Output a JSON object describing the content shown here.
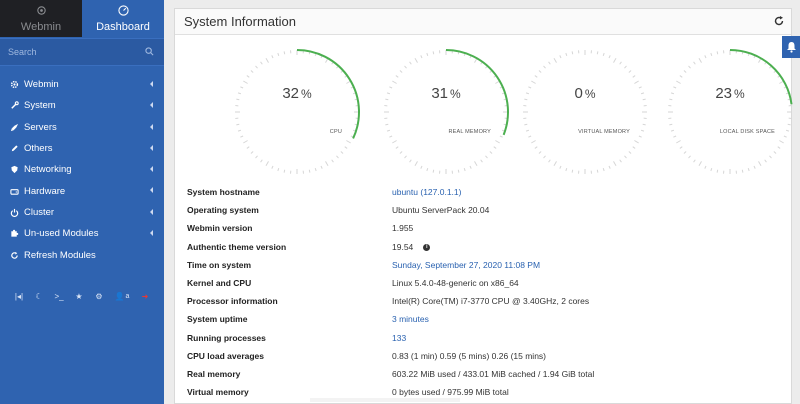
{
  "sidebar": {
    "tabs": [
      {
        "label": "Webmin",
        "icon": "webmin-icon"
      },
      {
        "label": "Dashboard",
        "icon": "dashboard-icon"
      }
    ],
    "search_placeholder": "Search",
    "items": [
      {
        "label": "Webmin",
        "icon": "gear-icon"
      },
      {
        "label": "System",
        "icon": "wrench-icon"
      },
      {
        "label": "Servers",
        "icon": "rocket-icon"
      },
      {
        "label": "Others",
        "icon": "edit-icon"
      },
      {
        "label": "Networking",
        "icon": "shield-icon"
      },
      {
        "label": "Hardware",
        "icon": "hdd-icon"
      },
      {
        "label": "Cluster",
        "icon": "power-icon"
      },
      {
        "label": "Un-used Modules",
        "icon": "puzzle-icon"
      },
      {
        "label": "Refresh Modules",
        "icon": "refresh-icon"
      }
    ],
    "bottom_icons": [
      "collapse-icon",
      "moon-icon",
      "terminal-icon",
      "star-icon",
      "cogs-icon",
      "user-icon",
      "logout-icon"
    ],
    "user_label": "a"
  },
  "panel": {
    "title": "System Information"
  },
  "gauges": [
    {
      "value": "32",
      "unit": "%",
      "label": "CPU",
      "fraction": 0.32
    },
    {
      "value": "31",
      "unit": "%",
      "label": "REAL MEMORY",
      "fraction": 0.31
    },
    {
      "value": "0",
      "unit": "%",
      "label": "VIRTUAL MEMORY",
      "fraction": 0.0
    },
    {
      "value": "23",
      "unit": "%",
      "label": "LOCAL DISK SPACE",
      "fraction": 0.23
    }
  ],
  "info": [
    {
      "key": "System hostname",
      "value": "ubuntu (127.0.1.1)",
      "link": true
    },
    {
      "key": "Operating system",
      "value": "Ubuntu ServerPack 20.04",
      "link": false
    },
    {
      "key": "Webmin version",
      "value": "1.955",
      "link": false
    },
    {
      "key": "Authentic theme version",
      "value": "19.54",
      "link": false,
      "info_icon": true
    },
    {
      "key": "Time on system",
      "value": "Sunday, September 27, 2020 11:08 PM",
      "link": true
    },
    {
      "key": "Kernel and CPU",
      "value": "Linux 5.4.0-48-generic on x86_64",
      "link": false
    },
    {
      "key": "Processor information",
      "value": "Intel(R) Core(TM) i7-3770 CPU @ 3.40GHz, 2 cores",
      "link": false
    },
    {
      "key": "System uptime",
      "value": "3 minutes",
      "link": true
    },
    {
      "key": "Running processes",
      "value": "133",
      "link": true
    },
    {
      "key": "CPU load averages",
      "value": "0.83 (1 min) 0.59 (5 mins) 0.26 (15 mins)",
      "link": false
    },
    {
      "key": "Real memory",
      "value": "603.22 MiB used / 433.01 MiB cached / 1.94 GiB total",
      "link": false
    },
    {
      "key": "Virtual memory",
      "value": "0 bytes used / 975.99 MiB total",
      "link": false
    }
  ],
  "colors": {
    "sidebar": "#2f63b0",
    "gauge_fill": "#4caf50",
    "link": "#2a62b0"
  }
}
